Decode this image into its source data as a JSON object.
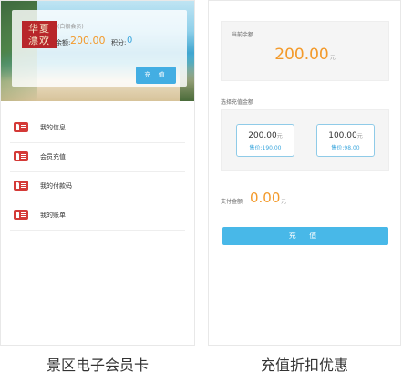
{
  "left_screen": {
    "logo_text": "华夏 漂欢",
    "member_level": "(白银会员)",
    "balance_label": "余额:",
    "balance_value": "200.00",
    "points_label": "积分:",
    "points_value": "0",
    "recharge_button": "充 值",
    "menu": [
      {
        "label": "我的信息",
        "icon": "member-card-icon"
      },
      {
        "label": "会员充值",
        "icon": "member-card-icon"
      },
      {
        "label": "我的付款码",
        "icon": "member-card-icon"
      },
      {
        "label": "我的账单",
        "icon": "member-card-icon"
      }
    ],
    "caption": "景区电子会员卡"
  },
  "right_screen": {
    "current_balance_label": "当前余额",
    "current_balance_value": "200.00",
    "currency_unit": "元",
    "select_amount_label": "选择充值金额",
    "options": [
      {
        "amount": "200.00",
        "unit": "元",
        "price": "售价:190.00"
      },
      {
        "amount": "100.00",
        "unit": "元",
        "price": "售价:98.00"
      }
    ],
    "pay_label": "支付金额",
    "pay_value": "0.00",
    "pay_unit": "元",
    "recharge_button": "充 值",
    "caption": "充值折扣优惠"
  },
  "colors": {
    "accent_orange": "#f39a2b",
    "accent_blue": "#43aee3",
    "menu_icon_red": "#d43a37",
    "logo_red": "#b8262a"
  }
}
